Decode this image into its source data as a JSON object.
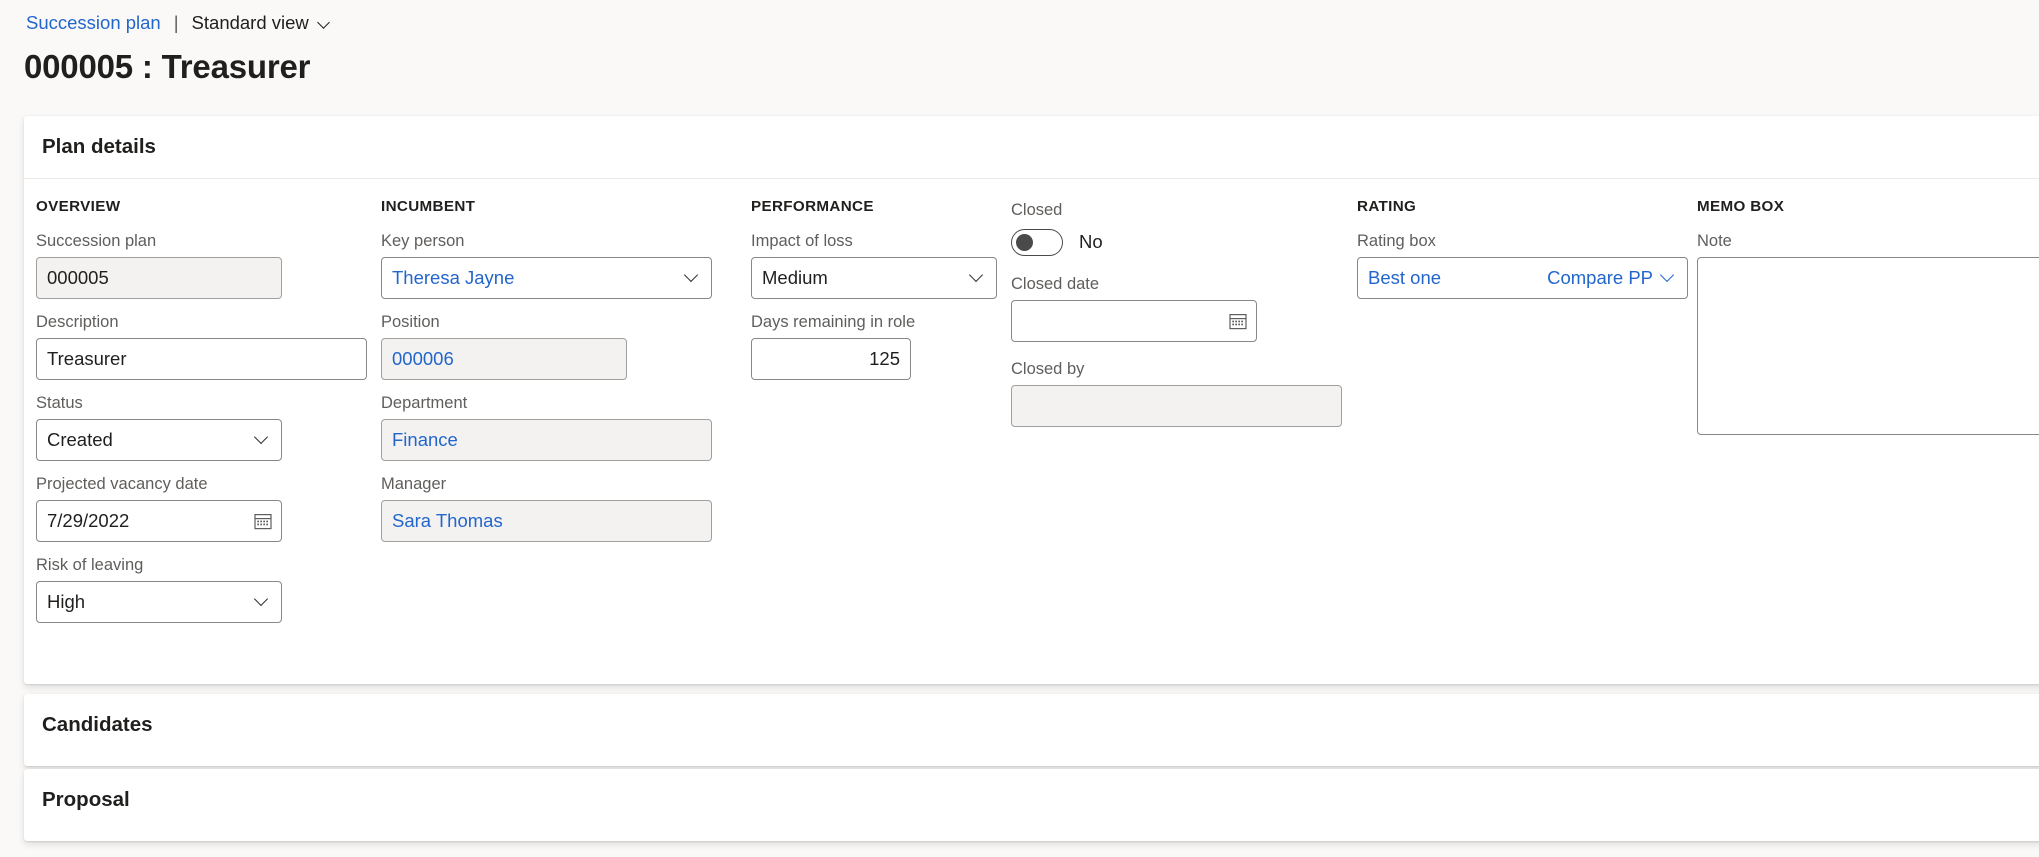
{
  "breadcrumb": {
    "link": "Succession plan",
    "separator": "|",
    "view": "Standard view"
  },
  "page_title": "000005 : Treasurer",
  "sections": {
    "plan_details": "Plan details",
    "candidates": "Candidates",
    "proposal": "Proposal"
  },
  "overview": {
    "group": "OVERVIEW",
    "succession_plan": {
      "label": "Succession plan",
      "value": "000005"
    },
    "description": {
      "label": "Description",
      "value": "Treasurer"
    },
    "status": {
      "label": "Status",
      "value": "Created"
    },
    "projected_vacancy_date": {
      "label": "Projected vacancy date",
      "value": "7/29/2022"
    },
    "risk_of_leaving": {
      "label": "Risk of leaving",
      "value": "High"
    }
  },
  "incumbent": {
    "group": "INCUMBENT",
    "key_person": {
      "label": "Key person",
      "value": "Theresa Jayne"
    },
    "position": {
      "label": "Position",
      "value": "000006"
    },
    "department": {
      "label": "Department",
      "value": "Finance"
    },
    "manager": {
      "label": "Manager",
      "value": "Sara Thomas"
    }
  },
  "performance": {
    "group": "PERFORMANCE",
    "impact_of_loss": {
      "label": "Impact of loss",
      "value": "Medium"
    },
    "days_remaining_in_role": {
      "label": "Days remaining in role",
      "value": "125"
    }
  },
  "closed_group": {
    "closed": {
      "label": "Closed",
      "value": "No",
      "state": "off"
    },
    "closed_date": {
      "label": "Closed date",
      "value": "",
      "placeholder": ""
    },
    "closed_by": {
      "label": "Closed by",
      "value": "",
      "placeholder": ""
    }
  },
  "rating": {
    "group": "RATING",
    "rating_box": {
      "label": "Rating box",
      "value": "Best one",
      "secondary": "Compare PP"
    }
  },
  "memo": {
    "group": "MEMO BOX",
    "note": {
      "label": "Note",
      "value": "",
      "placeholder": ""
    }
  },
  "colors": {
    "link": "#2266cc",
    "page_bg": "#faf9f8",
    "card_bg": "#ffffff",
    "readonly_bg": "#f3f2f1",
    "label": "#605e5c"
  },
  "icons": {
    "chevron_down": "chevron-down-icon",
    "calendar": "calendar-icon"
  }
}
